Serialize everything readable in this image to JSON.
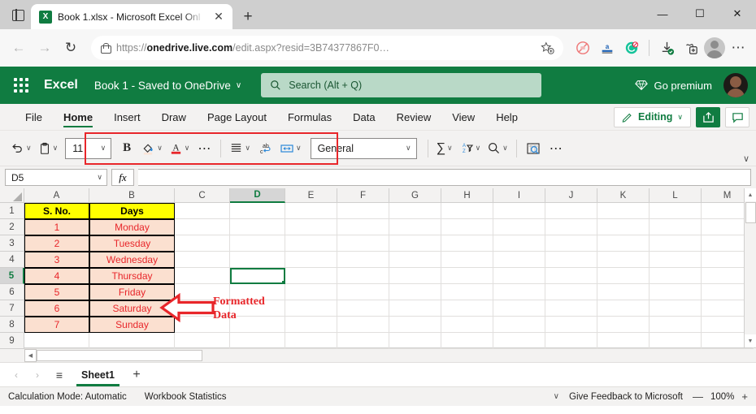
{
  "browser": {
    "tab": {
      "title": "Book 1.xlsx - Microsoft Excel Onl",
      "close": "✕",
      "icon": "excel-tab-icon",
      "letter": "X"
    },
    "new_tab": "+",
    "window": {
      "minimize": "—",
      "maximize": "☐",
      "close": "✕"
    },
    "nav": {
      "back": "←",
      "forward": "→",
      "reload": "↻"
    },
    "url": {
      "prefix": "https://",
      "domain": "onedrive.live.com",
      "path": "/edit.aspx?resid=3B74377867F0…"
    },
    "url_actions": {
      "favorite": "favorite-star-icon"
    },
    "extensions": [
      "adblock-icon",
      "grammar-a-icon",
      "grammarly-icon"
    ],
    "actions": {
      "downloads": "downloads-icon",
      "collections": "collections-icon",
      "profile": "profile-icon",
      "more": "⋯"
    }
  },
  "excel_header": {
    "waffle": "app-launcher-icon",
    "brand": "Excel",
    "doc_title": "Book 1  -  Saved to OneDrive",
    "doc_chevron": "∨",
    "search_placeholder": "Search (Alt + Q)",
    "search_icon": "search-icon",
    "premium_label": "Go premium",
    "premium_icon": "diamond-icon",
    "avatar": "user-avatar"
  },
  "ribbon": {
    "tabs": [
      {
        "label": "File",
        "active": false
      },
      {
        "label": "Home",
        "active": true
      },
      {
        "label": "Insert",
        "active": false
      },
      {
        "label": "Draw",
        "active": false
      },
      {
        "label": "Page Layout",
        "active": false
      },
      {
        "label": "Formulas",
        "active": false
      },
      {
        "label": "Data",
        "active": false
      },
      {
        "label": "Review",
        "active": false
      },
      {
        "label": "View",
        "active": false
      },
      {
        "label": "Help",
        "active": false
      }
    ],
    "editing_label": "Editing",
    "editing_icon": "pencil-icon",
    "editing_chevron": "∨",
    "share_icon": "share-icon",
    "comment_icon": "comment-icon",
    "collapse_chevron": "∨"
  },
  "toolbar": {
    "undo": "↶",
    "undo_chevron": "∨",
    "paste": "📋",
    "paste_chevron": "∨",
    "font_size": "11",
    "font_size_chevron": "∨",
    "bold": "B",
    "fill_color": "fill-color-icon",
    "fill_chevron": "∨",
    "font_color": "A",
    "font_color_chevron": "∨",
    "font_more": "⋯",
    "align": "align-icon",
    "align_chevron": "∨",
    "wrap_text": "wrap-text-icon",
    "merge": "merge-cells-icon",
    "merge_chevron": "∨",
    "number_format": "General",
    "number_format_chevron": "∨",
    "autosum": "∑",
    "autosum_chevron": "∨",
    "sort_filter": "sort-filter-icon",
    "sort_chevron": "∨",
    "find": "⌕",
    "find_chevron": "∨",
    "analyze": "analyze-data-icon",
    "more": "⋯"
  },
  "formula_bar": {
    "name_box": "D5",
    "name_chevron": "∨",
    "fx": "fx",
    "formula_value": ""
  },
  "grid": {
    "columns": [
      "A",
      "B",
      "C",
      "D",
      "E",
      "F",
      "G",
      "H",
      "I",
      "J",
      "K",
      "L",
      "M"
    ],
    "selected_column": "D",
    "rows": [
      "1",
      "2",
      "3",
      "4",
      "5",
      "6",
      "7",
      "8",
      "9"
    ],
    "selected_row": "5",
    "selected_cell": "D5",
    "table": {
      "headers": [
        "S. No.",
        "Days"
      ],
      "rows": [
        {
          "sno": "1",
          "day": "Monday"
        },
        {
          "sno": "2",
          "day": "Tuesday"
        },
        {
          "sno": "3",
          "day": "Wednesday"
        },
        {
          "sno": "4",
          "day": "Thursday"
        },
        {
          "sno": "5",
          "day": "Friday"
        },
        {
          "sno": "6",
          "day": "Saturday"
        },
        {
          "sno": "7",
          "day": "Sunday"
        }
      ]
    },
    "annotation": {
      "line1": "Formatted",
      "line2": "Data",
      "arrow": "left-arrow-annotation"
    },
    "colors": {
      "header_fill": "#FFFF00",
      "data_fill": "#FBE0D0",
      "data_text": "#E8262A",
      "selection": "#107C41",
      "highlight_box": "#E8262A"
    }
  },
  "sheet_bar": {
    "prev": "‹",
    "next": "›",
    "menu": "≡",
    "tabs": [
      "Sheet1"
    ],
    "add": "+"
  },
  "status_bar": {
    "calc_mode": "Calculation Mode: Automatic",
    "workbook_stats": "Workbook Statistics",
    "chevron": "∨",
    "feedback": "Give Feedback to Microsoft",
    "zoom_out": "—",
    "zoom_level": "100%",
    "zoom_in": "+"
  }
}
